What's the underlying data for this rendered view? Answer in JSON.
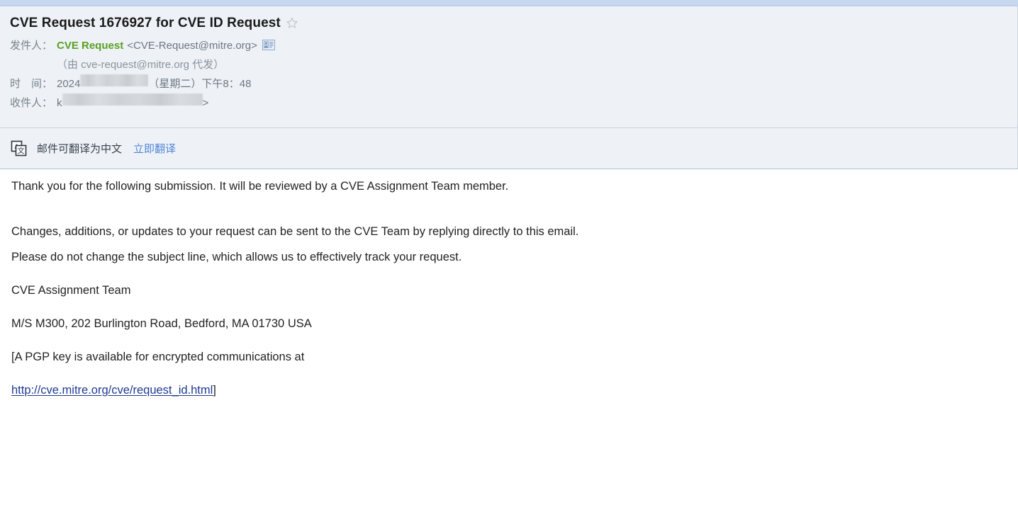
{
  "window": {
    "top_strip_color": "#c6d7ef",
    "header_bg": "#eef2f7",
    "body_bg": "#ffffff"
  },
  "header": {
    "subject": "CVE Request 1676927 for CVE ID Request",
    "star_icon": "star-outline-icon",
    "fields": {
      "from_label": "发件人：",
      "from_name": "CVE Request",
      "from_address": "<CVE-Request@mitre.org>",
      "from_name_color": "#5ba024",
      "contact_card_icon": "contact-card-icon",
      "on_behalf_of": "（由 cve-request@mitre.org 代发）",
      "date_label": "时　间：",
      "date_prefix": "2024",
      "date_weekday": "（星期二）",
      "date_time": "下午8：48",
      "to_label": "收件人：",
      "to_prefix": "k",
      "to_suffix": ">"
    }
  },
  "translate_bar": {
    "icon": "translate-icon",
    "message": "邮件可翻译为中文",
    "action_label": "立即翻译",
    "action_color": "#5086d8"
  },
  "body": {
    "paragraph_1": "Thank you for the following submission. It will be reviewed by a CVE Assignment Team member.",
    "paragraph_2_line_1": "Changes, additions, or updates to your request can be sent to the CVE Team by replying directly to this email.",
    "paragraph_2_line_2": "Please do not change the subject line, which allows us to effectively track your request.",
    "signature": "CVE Assignment Team",
    "address": "M/S M300, 202 Burlington Road, Bedford, MA 01730 USA",
    "pgp_line": "[A PGP key is available for encrypted communications at",
    "link_text": "http://cve.mitre.org/cve/request_id.html",
    "link_suffix": "]",
    "link_color": "#1f3a93"
  }
}
